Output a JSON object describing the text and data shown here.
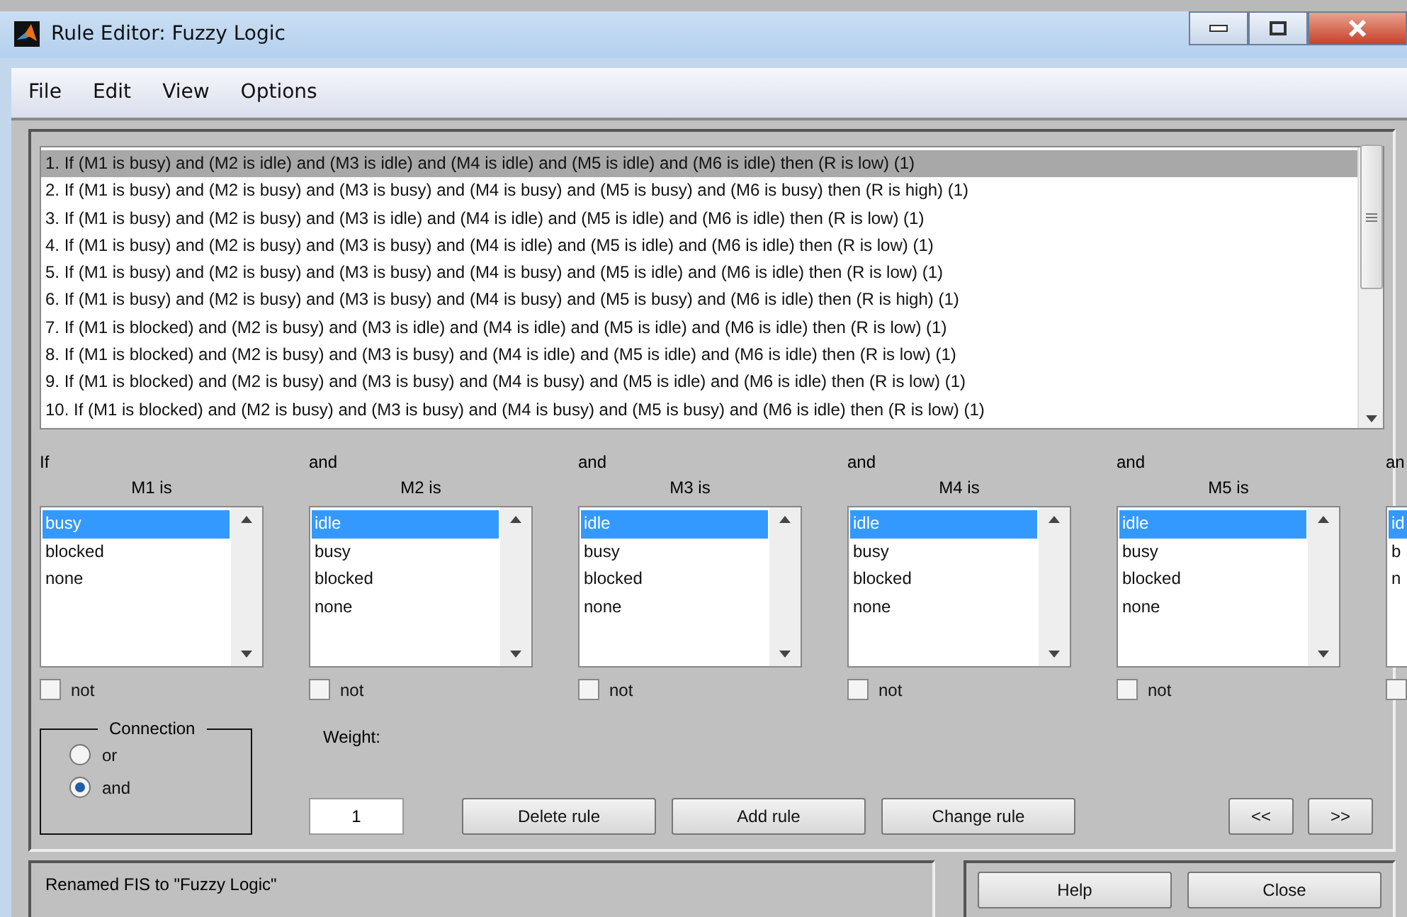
{
  "window": {
    "title": "Rule Editor: Fuzzy Logic"
  },
  "menu": [
    "File",
    "Edit",
    "View",
    "Options"
  ],
  "rules": [
    {
      "text": "1. If (M1 is busy) and (M2 is idle) and (M3 is idle) and (M4 is idle) and (M5 is idle) and (M6 is idle) then (R is low) (1)",
      "selected": true
    },
    {
      "text": "2. If (M1 is busy) and (M2 is busy) and (M3 is busy) and (M4 is busy) and (M5 is busy) and (M6 is busy) then (R is high) (1)",
      "selected": false
    },
    {
      "text": "3. If (M1 is busy) and (M2 is busy) and (M3 is idle) and (M4 is idle) and (M5 is idle) and (M6 is idle) then (R is low) (1)",
      "selected": false
    },
    {
      "text": "4. If (M1 is busy) and (M2 is busy) and (M3 is busy) and (M4 is idle) and (M5 is idle) and (M6 is idle) then (R is low) (1)",
      "selected": false
    },
    {
      "text": "5. If (M1 is busy) and (M2 is busy) and (M3 is busy) and (M4 is busy) and (M5 is idle) and (M6 is idle) then (R is low) (1)",
      "selected": false
    },
    {
      "text": "6. If (M1 is busy) and (M2 is busy) and (M3 is busy) and (M4 is busy) and (M5 is busy) and (M6 is idle) then (R is high) (1)",
      "selected": false
    },
    {
      "text": "7. If (M1 is blocked) and (M2 is busy) and (M3 is idle) and (M4 is idle) and (M5 is idle) and (M6 is idle) then (R is low) (1)",
      "selected": false
    },
    {
      "text": "8. If (M1 is blocked) and (M2 is busy) and (M3 is busy) and (M4 is idle) and (M5 is idle) and (M6 is idle) then (R is low) (1)",
      "selected": false
    },
    {
      "text": "9. If (M1 is blocked) and (M2 is busy) and (M3 is busy) and (M4 is busy) and (M5 is idle) and (M6 is idle) then (R is low) (1)",
      "selected": false
    },
    {
      "text": "10. If (M1 is blocked) and (M2 is busy) and (M3 is busy) and (M4 is busy) and (M5 is busy) and (M6 is idle) then (R is low) (1)",
      "selected": false
    }
  ],
  "inputs": [
    {
      "connector": "If",
      "label": "M1 is",
      "not": false,
      "not_label": "not",
      "items": [
        {
          "text": "busy",
          "selected": true
        },
        {
          "text": "blocked",
          "selected": false
        },
        {
          "text": "none",
          "selected": false
        }
      ]
    },
    {
      "connector": "and",
      "label": "M2 is",
      "not": false,
      "not_label": "not",
      "items": [
        {
          "text": "idle",
          "selected": true
        },
        {
          "text": "busy",
          "selected": false
        },
        {
          "text": "blocked",
          "selected": false
        },
        {
          "text": "none",
          "selected": false
        }
      ]
    },
    {
      "connector": "and",
      "label": "M3 is",
      "not": false,
      "not_label": "not",
      "items": [
        {
          "text": "idle",
          "selected": true
        },
        {
          "text": "busy",
          "selected": false
        },
        {
          "text": "blocked",
          "selected": false
        },
        {
          "text": "none",
          "selected": false
        }
      ]
    },
    {
      "connector": "and",
      "label": "M4 is",
      "not": false,
      "not_label": "not",
      "items": [
        {
          "text": "idle",
          "selected": true
        },
        {
          "text": "busy",
          "selected": false
        },
        {
          "text": "blocked",
          "selected": false
        },
        {
          "text": "none",
          "selected": false
        }
      ]
    },
    {
      "connector": "and",
      "label": "M5 is",
      "not": false,
      "not_label": "not",
      "items": [
        {
          "text": "idle",
          "selected": true
        },
        {
          "text": "busy",
          "selected": false
        },
        {
          "text": "blocked",
          "selected": false
        },
        {
          "text": "none",
          "selected": false
        }
      ]
    },
    {
      "connector": "an",
      "not": false,
      "items": [
        {
          "text": "id",
          "selected": true
        },
        {
          "text": "b",
          "selected": false
        },
        {
          "text": "n",
          "selected": false
        }
      ]
    }
  ],
  "connection": {
    "title": "Connection",
    "options": [
      {
        "label": "or",
        "selected": false
      },
      {
        "label": "and",
        "selected": true
      }
    ]
  },
  "weight": {
    "label": "Weight:",
    "value": "1"
  },
  "buttons": [
    "Delete rule",
    "Add rule",
    "Change rule"
  ],
  "nav": [
    "<<",
    ">>"
  ],
  "status": "Renamed FIS to \"Fuzzy Logic\"",
  "footer_buttons": [
    "Help",
    "Close"
  ]
}
